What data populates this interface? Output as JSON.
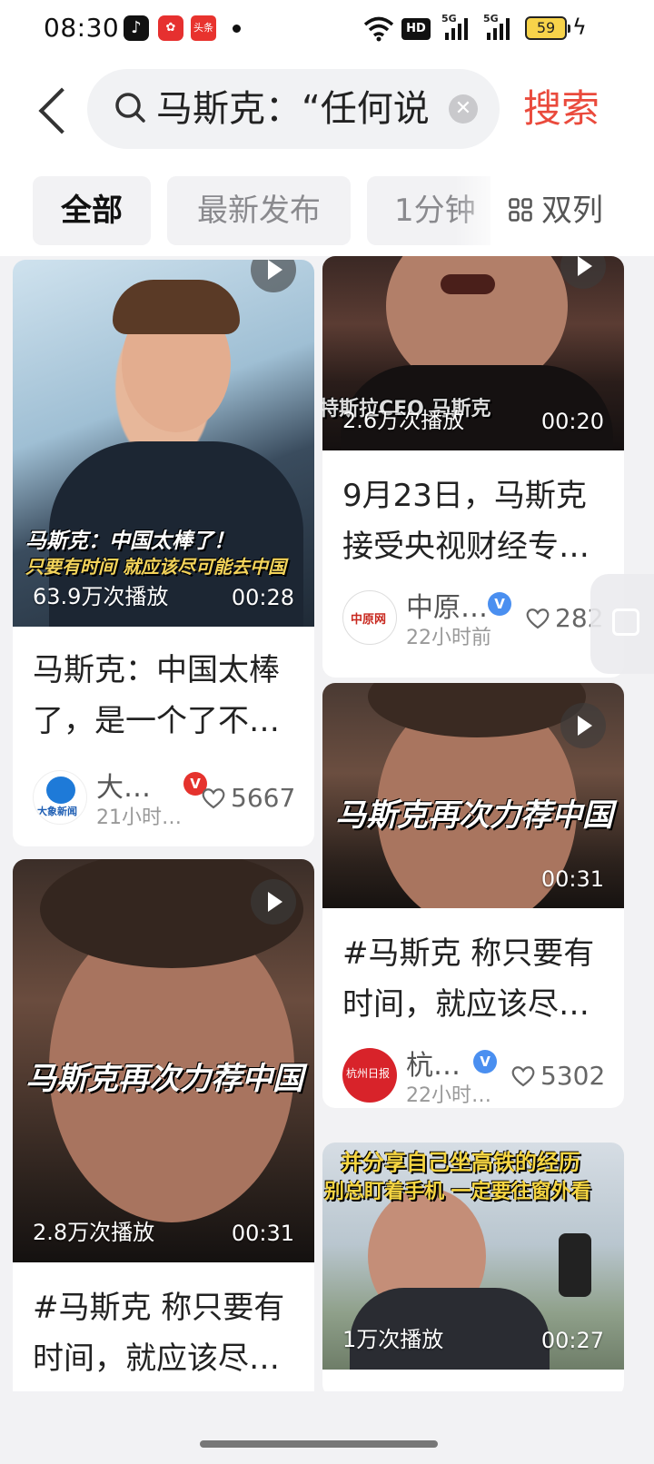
{
  "status_bar": {
    "time": "08:30",
    "app_badge_tiktok": "♪",
    "app_badge_red": "✿",
    "app_badge_news": "头条",
    "hd": "HD",
    "network_1": "5G",
    "network_2": "5G",
    "battery": "59"
  },
  "search": {
    "query": "马斯克：“任何说",
    "button_label": "搜索"
  },
  "filters": {
    "all": "全部",
    "latest": "最新发布",
    "duration": "1分钟",
    "layout_toggle": "双列"
  },
  "cards": [
    {
      "overlay_line1": "马斯克：中国太棒了！",
      "overlay_line2": "只要有时间 就应该尽可能去中国",
      "views": "63.9万次播放",
      "duration": "00:28",
      "title": "马斯克：中国太棒了，是一个了不…",
      "author": "大…",
      "time_ago": "21小时…",
      "likes": "5667",
      "avatar_text": "大象新闻"
    },
    {
      "overlay_line1": "特斯拉CEO 马斯克",
      "views": "2.6万次播放",
      "duration": "00:20",
      "title": "9月23日，马斯克接受央视财经专…",
      "author": "中原…",
      "time_ago": "22小时前",
      "likes": "282",
      "avatar_text": "中原网"
    },
    {
      "overlay_line1": "马斯克再次力荐中国",
      "duration": "00:31",
      "title": "#马斯克 称只要有时间，就应该尽…",
      "author": "杭…",
      "time_ago": "22小时…",
      "likes": "5302",
      "avatar_text": "杭州日报"
    },
    {
      "overlay_line1": "马斯克再次力荐中国",
      "views": "2.8万次播放",
      "duration": "00:31",
      "title": "#马斯克 称只要有时间，就应该尽…"
    },
    {
      "overlay_line1": "并分享自己坐高铁的经历",
      "overlay_line2": "别总盯着手机 一定要往窗外看",
      "views": "1万次播放",
      "duration": "00:27"
    }
  ],
  "colors": {
    "accent": "#ea4a3c",
    "background": "#f2f2f4",
    "verified_red": "#e5322d",
    "verified_blue": "#4a8ff0"
  }
}
